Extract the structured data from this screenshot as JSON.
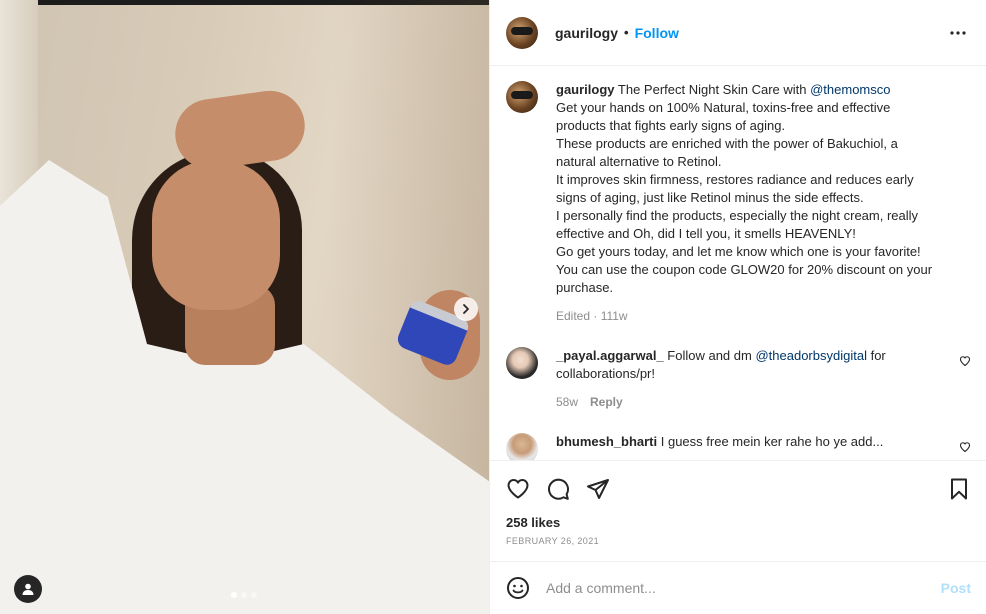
{
  "post": {
    "username": "gaurilogy",
    "follow_label": "Follow",
    "separator": "•",
    "caption_lines": [
      "The Perfect Night Skin Care with",
      "Get your hands on 100% Natural, toxins-free and effective",
      "products that fights early signs of aging.",
      "These products are enriched with the power of Bakuchiol, a",
      "natural alternative to Retinol.",
      "It improves skin firmness, restores radiance and reduces early",
      "signs of aging, just like Retinol minus the side effects.",
      "I personally find the products, especially the night cream, really",
      "effective and Oh, did I tell you, it smells HEAVENLY!",
      "Go get yours today, and let me know which one is your favorite!",
      "You can use the coupon code GLOW20 for 20% discount on your",
      "purchase."
    ],
    "caption_mention": "@themomsco",
    "caption_meta": "Edited · 111w",
    "likes": "258 likes",
    "date": "February 26, 2021"
  },
  "comments": [
    {
      "username": "_payal.aggarwal_",
      "text_before": "Follow and dm",
      "mention": "@theadorbsydigital",
      "text_after": "for",
      "text_line2": "collaborations/pr!",
      "time": "58w",
      "reply_label": "Reply"
    },
    {
      "username": "bhumesh_bharti",
      "text": "I guess free mein ker rahe ho ye add..."
    }
  ],
  "composer": {
    "placeholder": "Add a comment...",
    "post_label": "Post"
  },
  "carousel": {
    "slides": 3,
    "active_index": 0
  },
  "colors": {
    "accent": "#0095f6",
    "mention": "#00376b",
    "muted": "#8e8e8e",
    "post_disabled": "#b2dffc"
  },
  "icons": {
    "more": "more-horizontal-icon",
    "like": "heart-icon",
    "comment": "comment-icon",
    "share": "paper-plane-icon",
    "save": "bookmark-icon",
    "emoji": "emoji-icon",
    "tag": "user-tag-icon",
    "next": "chevron-right-icon"
  }
}
